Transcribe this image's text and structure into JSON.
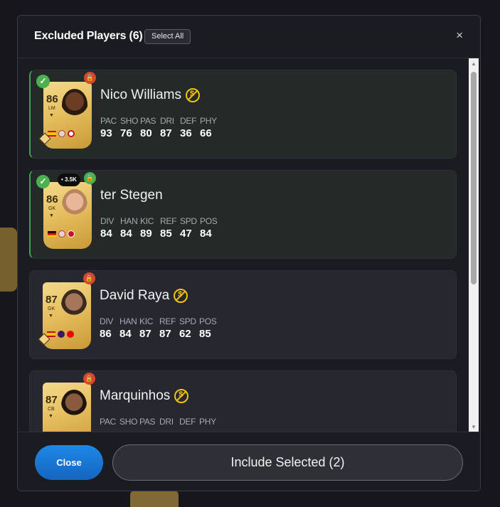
{
  "modal": {
    "title": "Excluded Players (6)",
    "select_all_label": "Select All",
    "close_icon": "×"
  },
  "players": [
    {
      "name": "Nico Williams",
      "rating": "86",
      "position": "LM",
      "selected": true,
      "locked": true,
      "untradeable": true,
      "price": "",
      "stat_labels": [
        "PAC",
        "SHO",
        "PAS",
        "DRI",
        "DEF",
        "PHY"
      ],
      "stat_values": [
        "93",
        "76",
        "80",
        "87",
        "36",
        "66"
      ]
    },
    {
      "name": "ter Stegen",
      "rating": "86",
      "position": "GK",
      "selected": true,
      "locked": false,
      "untradeable": false,
      "price": "3.5K",
      "stat_labels": [
        "DIV",
        "HAN",
        "KIC",
        "REF",
        "SPD",
        "POS"
      ],
      "stat_values": [
        "84",
        "84",
        "89",
        "85",
        "47",
        "84"
      ]
    },
    {
      "name": "David Raya",
      "rating": "87",
      "position": "GK",
      "selected": false,
      "locked": true,
      "untradeable": true,
      "price": "",
      "stat_labels": [
        "DIV",
        "HAN",
        "KIC",
        "REF",
        "SPD",
        "POS"
      ],
      "stat_values": [
        "86",
        "84",
        "87",
        "87",
        "62",
        "85"
      ]
    },
    {
      "name": "Marquinhos",
      "rating": "87",
      "position": "CB",
      "selected": false,
      "locked": true,
      "untradeable": true,
      "price": "",
      "stat_labels": [
        "PAC",
        "SHO",
        "PAS",
        "DRI",
        "DEF",
        "PHY"
      ],
      "stat_values": []
    }
  ],
  "footer": {
    "close_label": "Close",
    "include_label": "Include Selected (2)"
  },
  "colors": {
    "accent_blue": "#1e88e5",
    "selected_green": "#4caf50",
    "untradeable_gold": "#f4c20d",
    "lock_red": "#d8462e"
  }
}
